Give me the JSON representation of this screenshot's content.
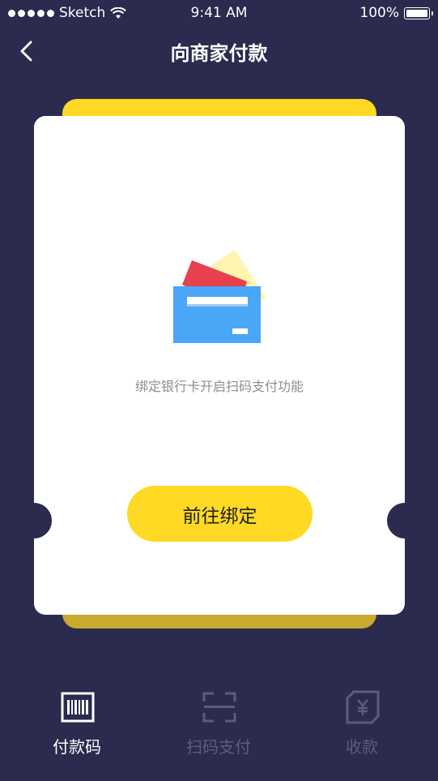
{
  "status_bar": {
    "carrier": "Sketch",
    "time": "9:41 AM",
    "battery": "100%",
    "signal_dots": 5
  },
  "nav": {
    "title": "向商家付款",
    "back_icon": "chevron-left-icon"
  },
  "card": {
    "illustration": "wallet-card-icon",
    "hint": "绑定银行卡开启扫码支付功能",
    "bind_button_label": "前往绑定"
  },
  "tabs": [
    {
      "label": "付款码",
      "icon": "barcode-icon",
      "active": true
    },
    {
      "label": "扫码支付",
      "icon": "scan-icon",
      "active": false
    },
    {
      "label": "收款",
      "icon": "receive-money-icon",
      "active": false
    }
  ],
  "colors": {
    "background": "#2a2b4e",
    "accent_yellow": "#ffd923",
    "card_white": "#ffffff",
    "inactive_tab": "#5c5d77"
  }
}
